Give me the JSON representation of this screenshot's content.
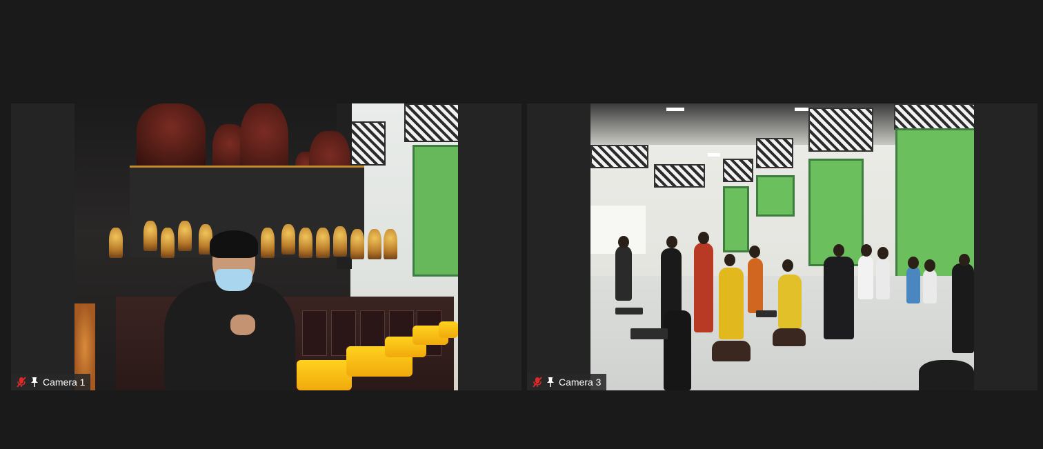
{
  "window": {
    "layout": "gallery-view"
  },
  "participants": [
    {
      "name": "Camera 1",
      "muted": true,
      "pinned": true,
      "icons": [
        "mic-muted-icon",
        "pin-icon"
      ]
    },
    {
      "name": "Camera 3",
      "muted": true,
      "pinned": true,
      "icons": [
        "mic-muted-icon",
        "pin-icon"
      ]
    }
  ],
  "colors": {
    "background": "#1a1a1a",
    "tile_background": "#242424",
    "label_background": "#282828",
    "label_text": "#ffffff",
    "muted_mic": "#e02828"
  }
}
